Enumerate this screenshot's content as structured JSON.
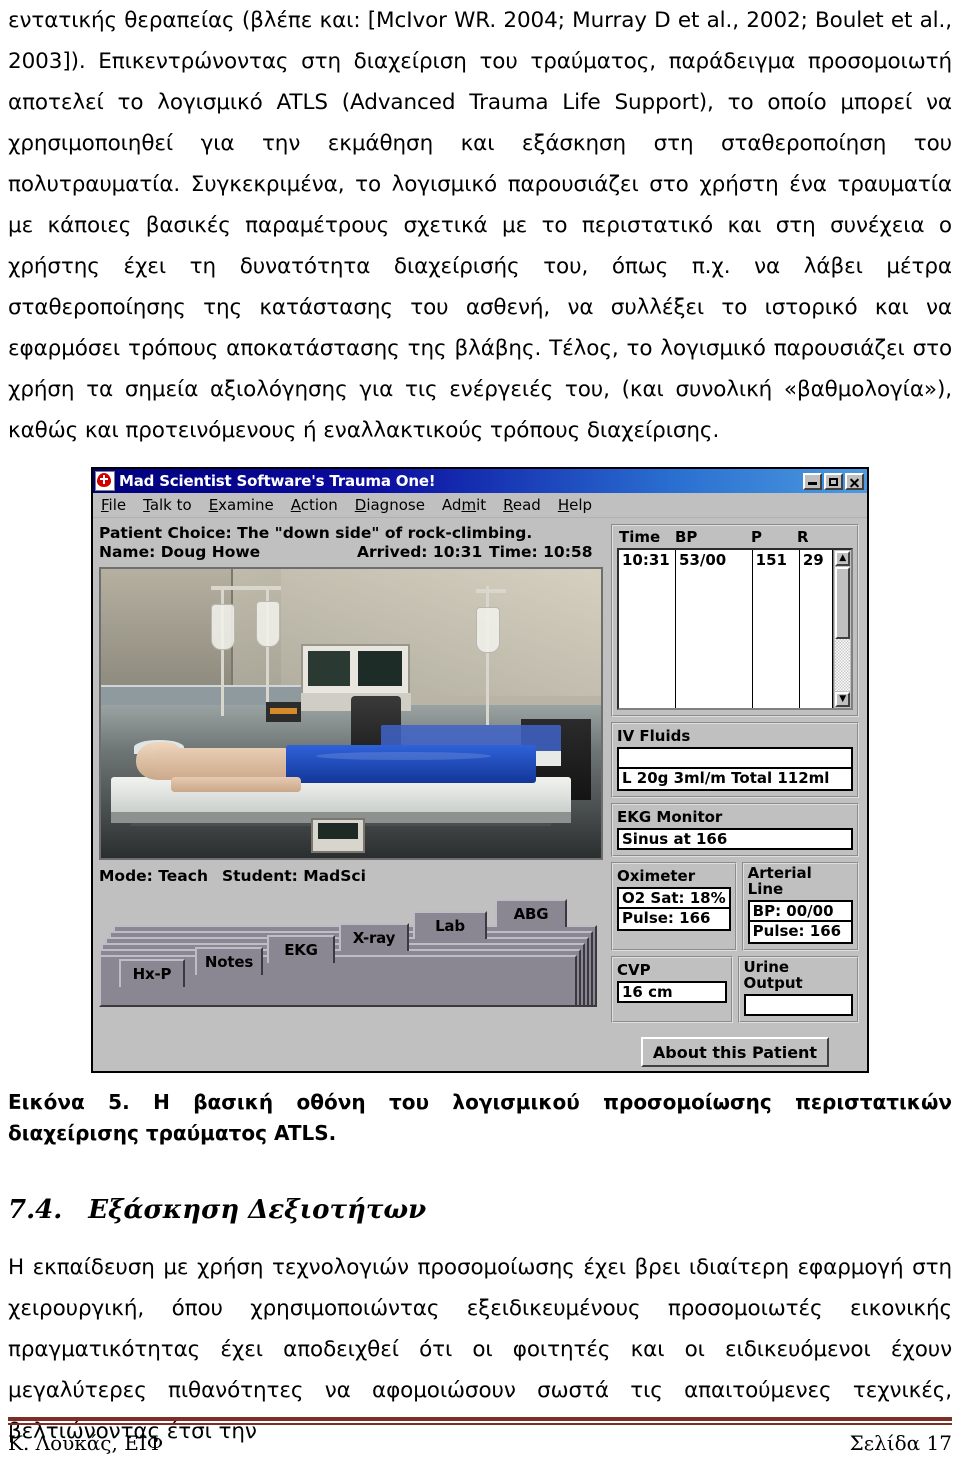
{
  "document": {
    "paragraphs": [
      "εντατικής θεραπείας (βλέπε και: [McIvor WR.  2004; Murray D et al., 2002; Boulet et al., 2003]). Επικεντρώνοντας στη διαχείριση του τραύματος, παράδειγμα προσομοιωτή αποτελεί το λογισμικό ATLS (Advanced Trauma Life Support), το οποίο μπορεί να χρησιμοποιηθεί για την εκμάθηση και εξάσκηση στη σταθεροποίηση του πολυτραυματία. Συγκεκριμένα, το λογισμικό παρουσιάζει στο χρήστη ένα τραυματία με κάποιες βασικές παραμέτρους σχετικά με το περιστατικό και στη συνέχεια ο χρήστης έχει τη δυνατότητα διαχείρισής του, όπως π.χ. να λάβει μέτρα σταθεροποίησης της κατάστασης του ασθενή, να συλλέξει το ιστορικό και να εφαρμόσει τρόπους αποκατάστασης της βλάβης. Τέλος, το λογισμικό παρουσιάζει στο χρήση τα σημεία αξιολόγησης για τις ενέργειές του, (και συνολική «βαθμολογία»), καθώς και προτεινόμενους ή εναλλακτικούς τρόπους διαχείρισης."
    ],
    "figure_caption": "Εικόνα 5. Η βασική οθόνη του λογισμικού προσομοίωσης περιστατικών διαχείρισης τραύματος ATLS.",
    "section_number": "7.4.",
    "section_title": "Εξάσκηση Δεξιοτήτων",
    "closing_paragraph": "Η εκπαίδευση με χρήση τεχνολογιών προσομοίωσης έχει βρει ιδιαίτερη εφαρμογή στη χειρουργική, όπου χρησιμοποιώντας εξειδικευμένους προσομοιωτές εικονικής πραγματικότητας έχει αποδειχθεί ότι οι φοιτητές και οι ειδικευόμενοι έχουν μεγαλύτερες πιθανότητες να αφομοιώσουν σωστά τις απαιτούμενες τεχνικές, βελτιώνοντας έτσι την",
    "footer_left": "Κ. Λουκάς, ΕΙΦ",
    "footer_right": "Σελίδα 17",
    "rule_color": "#7b2d26"
  },
  "app": {
    "window_title": "Mad Scientist Software's Trauma One!",
    "title_icon": "heart-cross-icon",
    "window_buttons": {
      "minimize": "minimize-icon",
      "maximize": "maximize-icon",
      "close": "close-icon"
    },
    "menu": [
      {
        "accel": "F",
        "rest": "ile"
      },
      {
        "accel": "T",
        "rest": "alk to"
      },
      {
        "accel": "E",
        "rest": "xamine"
      },
      {
        "accel": "A",
        "rest": "ction"
      },
      {
        "accel": "D",
        "rest": "iagnose"
      },
      {
        "accel": "A",
        "rest": "dmit"
      },
      {
        "accel": "R",
        "rest": "ead"
      },
      {
        "accel": "H",
        "rest": "elp"
      }
    ],
    "menu_flat": [
      "File",
      "Talk to",
      "Examine",
      "Action",
      "Diagnose",
      "Admit",
      "Read",
      "Help"
    ],
    "patient_choice": "Patient Choice: The \"down side\" of rock-climbing.",
    "patient_name": "Name: Doug Howe",
    "arrived": "Arrived: 10:31",
    "time": "Time: 10:58",
    "photo_alt": "trauma-bay-patient-photo",
    "mode": "Mode: Teach",
    "student": "Student: MadSci",
    "tabs": [
      "Hx-P",
      "Notes",
      "EKG",
      "X-ray",
      "Lab",
      "ABG"
    ],
    "vitals": {
      "headers": [
        "Time",
        "BP",
        "P",
        "R"
      ],
      "rows": [
        {
          "time": "10:31",
          "bp": "53/00",
          "p": "151",
          "r": "29"
        }
      ]
    },
    "iv_fluids": {
      "legend": "IV Fluids",
      "line1": "",
      "line2": "L 20g 3ml/m Total 112ml"
    },
    "ekg_monitor": {
      "legend": "EKG Monitor",
      "value": "Sinus at  166"
    },
    "oximeter": {
      "legend": "Oximeter",
      "o2_sat": "O2 Sat: 18%",
      "pulse": "Pulse: 166"
    },
    "arterial_line": {
      "legend": "Arterial Line",
      "bp": "BP: 00/00",
      "pulse": "Pulse: 166"
    },
    "cvp": {
      "legend": "CVP",
      "value": "16 cm"
    },
    "urine_output": {
      "legend": "Urine Output",
      "value": ""
    },
    "about_button": "About this Patient",
    "scroll_up_icon": "triangle-up-icon",
    "scroll_down_icon": "triangle-down-icon"
  }
}
